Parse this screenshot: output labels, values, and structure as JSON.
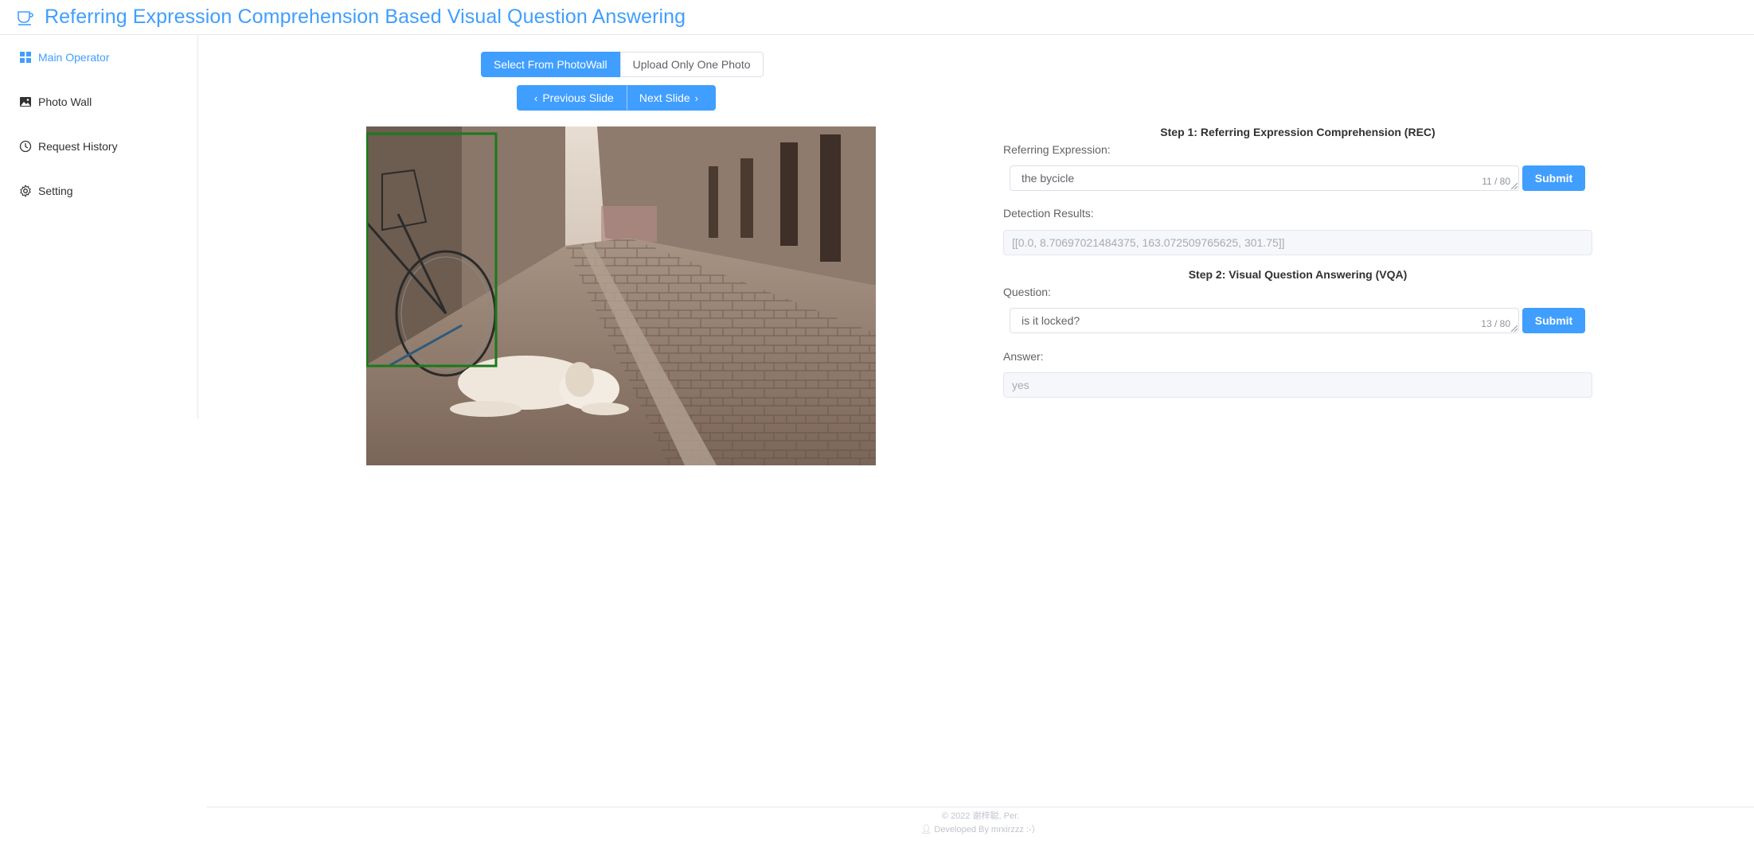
{
  "header": {
    "title": "Referring Expression Comprehension Based Visual Question Answering",
    "logo_icon": "coffee-cup-icon",
    "accent": "#409eff"
  },
  "sidebar": {
    "items": [
      {
        "label": "Main Operator",
        "icon": "grid-icon",
        "active": true
      },
      {
        "label": "Photo Wall",
        "icon": "picture-icon",
        "active": false
      },
      {
        "label": "Request History",
        "icon": "clock-icon",
        "active": false
      },
      {
        "label": "Setting",
        "icon": "gear-icon",
        "active": false
      }
    ]
  },
  "main": {
    "source_tabs": {
      "photowall": "Select From PhotoWall",
      "upload": "Upload Only One Photo"
    },
    "slides": {
      "previous": "Previous Slide",
      "next": "Next Slide"
    },
    "photo": {
      "description_icon": "photo-icon"
    },
    "rec": {
      "title": "Step 1: Referring Expression Comprehension (REC)",
      "expression_label": "Referring Expression:",
      "expression_value": "the bycicle",
      "expression_count": "11 / 80",
      "submit": "Submit",
      "results_label": "Detection Results:",
      "results_value": "[[0.0, 8.70697021484375, 163.072509765625, 301.75]]"
    },
    "vqa": {
      "title": "Step 2: Visual Question Answering (VQA)",
      "question_label": "Question:",
      "question_value": "is it locked?",
      "question_count": "13 / 80",
      "submit": "Submit",
      "answer_label": "Answer:",
      "answer_value": "yes"
    }
  },
  "footer": {
    "copyright": "© 2022 谢梓聪, Per.",
    "developer": "Developed By mrxirzzz :-）"
  }
}
